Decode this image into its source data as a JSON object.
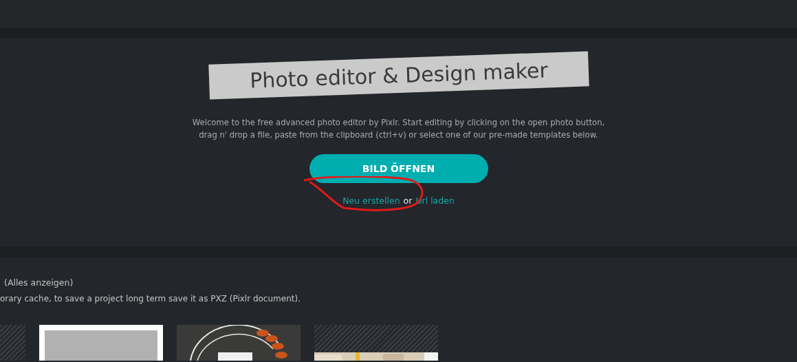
{
  "hero": {
    "title": "Photo editor & Design maker",
    "description": "Welcome to the free advanced photo editor by Pixlr. Start editing by clicking on the open photo button, drag n' drop a file, paste from the clipboard (ctrl+v) or select one of our pre-made templates below.",
    "open_button": "BILD ÖFFNEN",
    "create_link": "Neu erstellen",
    "separator": "or",
    "url_link": "Url laden"
  },
  "recent": {
    "show_all_link": "(Alles anzeigen)",
    "note": "orary cache, to save a project long term save it as PXZ (Pixlr document)."
  },
  "thumbnails": [
    {
      "kind": "hatched"
    },
    {
      "kind": "frame"
    },
    {
      "kind": "picture"
    },
    {
      "kind": "hatched-picture"
    }
  ]
}
